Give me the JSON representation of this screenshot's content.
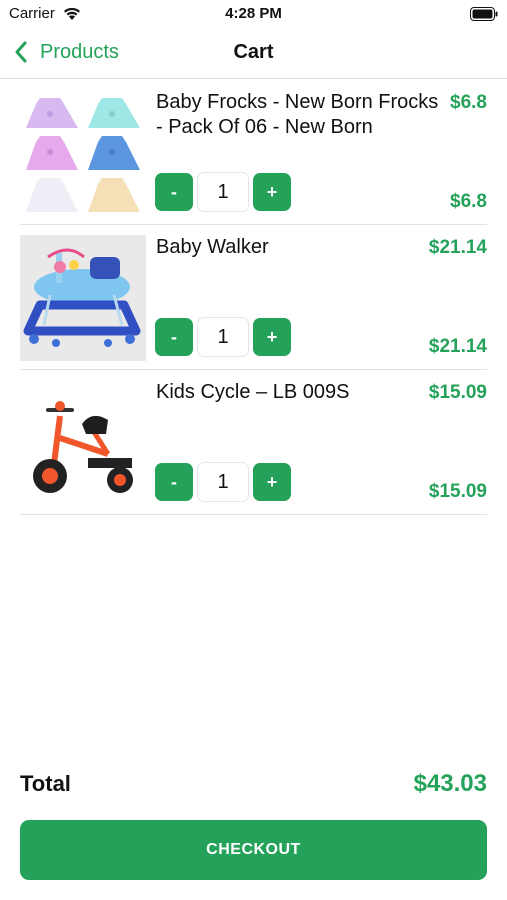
{
  "status_bar": {
    "carrier": "Carrier",
    "time": "4:28 PM",
    "icons": [
      "wifi-icon",
      "battery-icon"
    ]
  },
  "nav": {
    "back_label": "Products",
    "title": "Cart",
    "back_icon": "chevron-left-icon"
  },
  "cart": {
    "items": [
      {
        "name": "Baby Frocks - New Born Frocks - Pack Of 06 - New Born",
        "price": "$6.8",
        "quantity": "1",
        "line_total": "$6.8",
        "decrement_label": "-",
        "increment_label": "+",
        "image": "baby-frocks-image"
      },
      {
        "name": "Baby Walker",
        "price": "$21.14",
        "quantity": "1",
        "line_total": "$21.14",
        "decrement_label": "-",
        "increment_label": "+",
        "image": "baby-walker-image"
      },
      {
        "name": "Kids Cycle – LB 009S",
        "price": "$15.09",
        "quantity": "1",
        "line_total": "$15.09",
        "decrement_label": "-",
        "increment_label": "+",
        "image": "kids-cycle-image"
      }
    ]
  },
  "summary": {
    "total_label": "Total",
    "total_value": "$43.03",
    "checkout_label": "CHECKOUT"
  },
  "colors": {
    "accent": "#24a25a",
    "divider": "#e2e2e2",
    "text": "#111111"
  }
}
